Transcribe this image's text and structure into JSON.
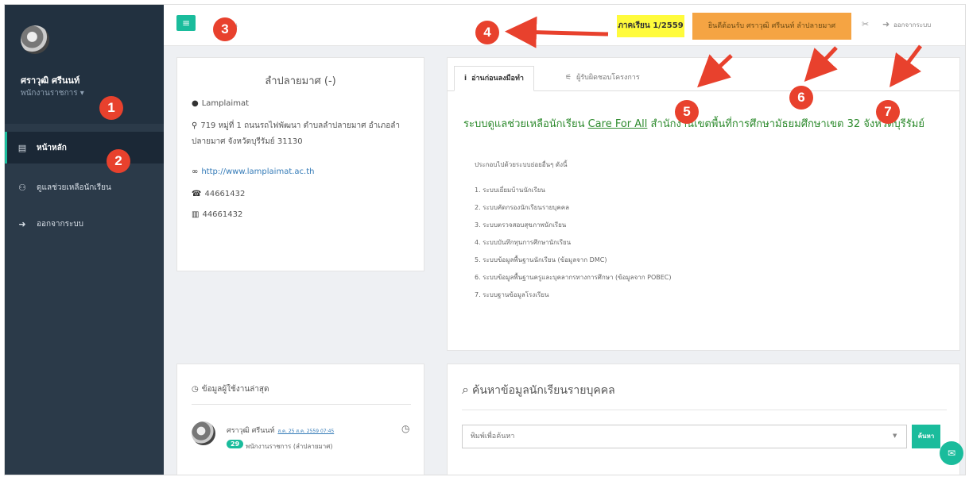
{
  "sidebar": {
    "user_name": "ศราวุฒิ ศรีนนท์",
    "user_role": "พนักงานราชการ ▾",
    "items": [
      {
        "icon": "newspaper-icon",
        "label": "หน้าหลัก"
      },
      {
        "icon": "users-icon",
        "label": "ดูแลช่วยเหลือนักเรียน"
      },
      {
        "icon": "sign-out-icon",
        "label": "ออกจากระบบ"
      }
    ]
  },
  "topbar": {
    "menu_text": "เมนู",
    "term": "ภาคเรียน 1/2559",
    "welcome": "ยินดีต้อนรับ ศราวุฒิ ศรีนนท์ ลำปลายมาศ",
    "logout": "ออกจากระบบ"
  },
  "school": {
    "title": "ลำปลายมาศ (-)",
    "name_en": "Lamplaimat",
    "address": "719 หมู่ที่ 1 ถนนรถไฟพัฒนา ตำบลลำปลายมาศ อำเภอลำปลายมาศ จังหวัดบุรีรัมย์ 31130",
    "website": "http://www.lamplaimat.ac.th",
    "phone": "44661432",
    "fax": "44661432"
  },
  "main": {
    "tabs": [
      "อ่านก่อนลงมือทำ",
      "ผู้รับผิดชอบโครงการ"
    ],
    "headline_pre": "ระบบดูแลช่วยเหลือนักเรียน ",
    "headline_link": "Care For All",
    "headline_post": " สำนักงานเขตพื้นที่การศึกษามัธยมศึกษาเขต 32 จังหวัดบุรีรัมย์",
    "intro": "ประกอบไปด้วยระบบย่อยอื่นๆ ดังนี้",
    "systems": [
      "1. ระบบเยี่ยมบ้านนักเรียน",
      "2. ระบบคัดกรองนักเรียนรายบุคคล",
      "3. ระบบตรวจสอบสุขภาพนักเรียน",
      "4. ระบบบันทึกทุนการศึกษานักเรียน",
      "5. ระบบข้อมูลพื้นฐานนักเรียน (ข้อมูลจาก DMC)",
      "6. ระบบข้อมูลพื้นฐานครูและบุคลากรทางการศึกษา (ข้อมูลจาก POBEC)",
      "7. ระบบฐานข้อมูลโรงเรียน"
    ]
  },
  "recent": {
    "title": "ข้อมูลผู้ใช้งานล่าสุด",
    "user_name": "ศราวุฒิ ศรีนนท์",
    "time": "ส.ค. 25 ส.ค. 2559 07:45",
    "count": "29",
    "role": "พนักงานราชการ (ลำปลายมาศ)"
  },
  "search": {
    "title": "ค้นหาข้อมูลนักเรียนรายบุคคล",
    "placeholder": "พิมพ์เพื่อค้นหา",
    "button": "ค้นหา"
  },
  "callouts": [
    "1",
    "2",
    "3",
    "4",
    "5",
    "6",
    "7"
  ],
  "colors": {
    "accent": "#1abc9c",
    "callout": "#e8412d",
    "term_badge": "#fffb3c",
    "welcome_badge": "#f5a443",
    "sidebar": "#2b3a49"
  }
}
